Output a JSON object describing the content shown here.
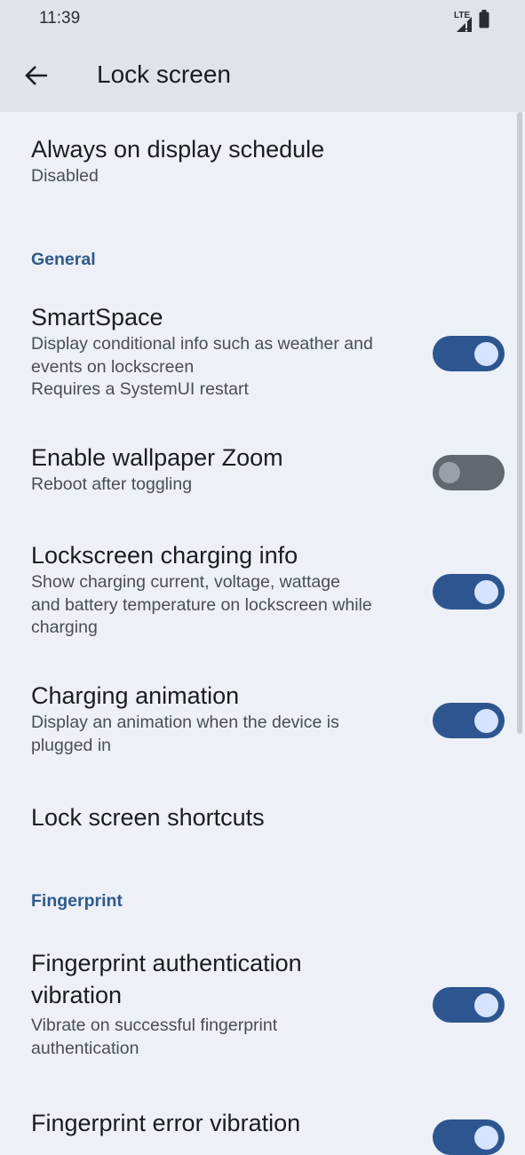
{
  "status_bar": {
    "time": "11:39",
    "network": "LTE"
  },
  "app_bar": {
    "title": "Lock screen"
  },
  "items": {
    "aod": {
      "title": "Always on display schedule",
      "subtitle": "Disabled"
    },
    "smartspace": {
      "title": "SmartSpace",
      "subtitle": "Display conditional info such as weather and\nevents on lockscreen\nRequires a SystemUI restart",
      "enabled": true
    },
    "wallpaper_zoom": {
      "title": "Enable wallpaper Zoom",
      "subtitle": "Reboot after toggling",
      "enabled": false
    },
    "charging_info": {
      "title": "Lockscreen charging info",
      "subtitle": "Show charging current, voltage, wattage\nand battery temperature on lockscreen while\ncharging",
      "enabled": true
    },
    "charging_animation": {
      "title": "Charging animation",
      "subtitle": "Display an animation when the device is\nplugged in",
      "enabled": true
    },
    "shortcuts": {
      "title": "Lock screen shortcuts"
    },
    "fp_auth_vibration": {
      "title": "Fingerprint authentication\nvibration",
      "subtitle": "Vibrate on successful fingerprint\nauthentication",
      "enabled": true
    },
    "fp_error_vibration": {
      "title": "Fingerprint error vibration",
      "enabled": true
    }
  },
  "sections": {
    "general": "General",
    "fingerprint": "Fingerprint"
  },
  "colors": {
    "accent": "#2d5690",
    "switch_off": "#626770",
    "section": "#2e5a8c",
    "background": "#edf0f7",
    "appbar": "#e1e3ea"
  }
}
